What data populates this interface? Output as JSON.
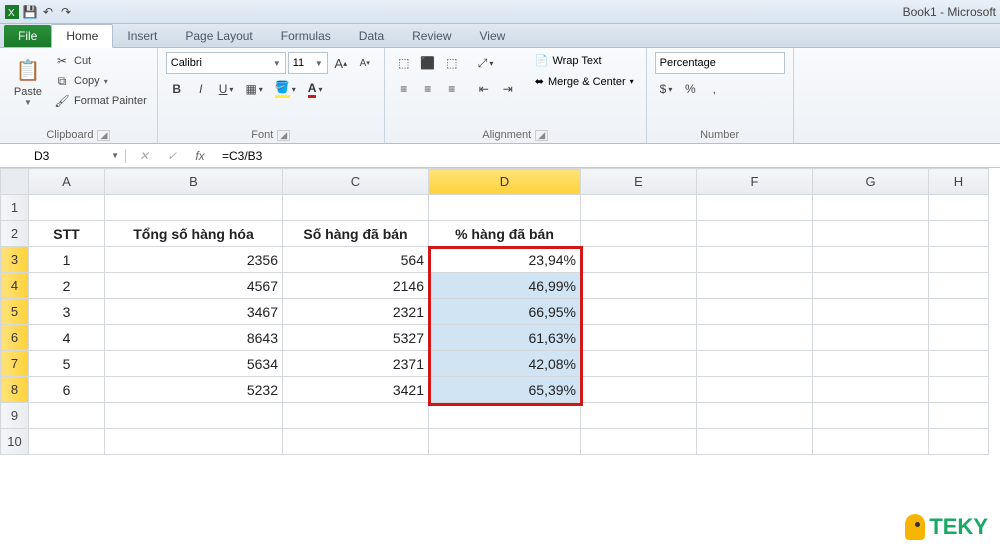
{
  "title": "Book1 - Microsoft",
  "tabs": {
    "file": "File",
    "home": "Home",
    "insert": "Insert",
    "pagelayout": "Page Layout",
    "formulas": "Formulas",
    "data": "Data",
    "review": "Review",
    "view": "View"
  },
  "clipboard": {
    "paste": "Paste",
    "cut": "Cut",
    "copy": "Copy",
    "fp": "Format Painter",
    "label": "Clipboard"
  },
  "font": {
    "name": "Calibri",
    "size": "11",
    "label": "Font"
  },
  "alignment": {
    "wrap": "Wrap Text",
    "merge": "Merge & Center",
    "label": "Alignment"
  },
  "number": {
    "fmt": "Percentage",
    "label": "Number"
  },
  "namebox": "D3",
  "formula": "=C3/B3",
  "cols": [
    "A",
    "B",
    "C",
    "D",
    "E",
    "F",
    "G",
    "H"
  ],
  "headers": {
    "a": "STT",
    "b": "Tổng số hàng hóa",
    "c": "Số hàng đã bán",
    "d": "% hàng đã bán"
  },
  "rows": [
    {
      "n": "1",
      "a": "1",
      "b": "2356",
      "c": "564",
      "d": "23,94%"
    },
    {
      "n": "2",
      "a": "2",
      "b": "4567",
      "c": "2146",
      "d": "46,99%"
    },
    {
      "n": "3",
      "a": "3",
      "b": "3467",
      "c": "2321",
      "d": "66,95%"
    },
    {
      "n": "4",
      "a": "4",
      "b": "8643",
      "c": "5327",
      "d": "61,63%"
    },
    {
      "n": "5",
      "a": "5",
      "b": "5634",
      "c": "2371",
      "d": "42,08%"
    },
    {
      "n": "6",
      "a": "6",
      "b": "5232",
      "c": "3421",
      "d": "65,39%"
    }
  ],
  "logo": "TEKY"
}
